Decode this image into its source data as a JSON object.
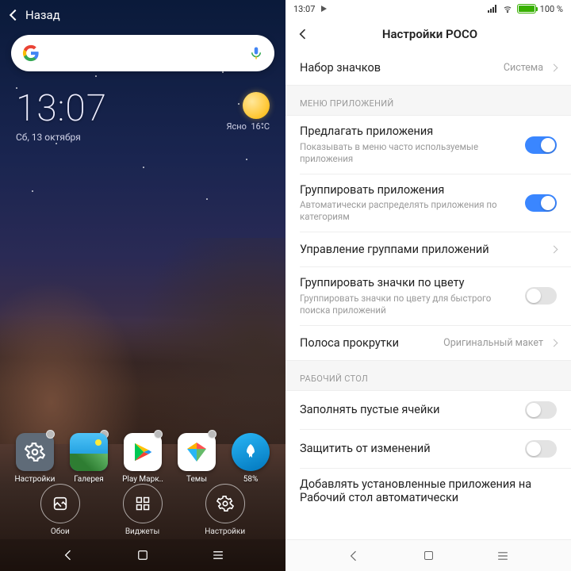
{
  "left": {
    "back_label": "Назад",
    "clock": {
      "time": "13:07",
      "date": "Сб, 13 октября"
    },
    "weather": {
      "desc": "Ясно",
      "temp": "16°C"
    },
    "apps": [
      {
        "name": "settings",
        "label": "Настройки",
        "dot": true
      },
      {
        "name": "gallery",
        "label": "Галерея",
        "dot": true
      },
      {
        "name": "play",
        "label": "Play Марк..",
        "dot": true
      },
      {
        "name": "themes",
        "label": "Темы",
        "dot": true
      },
      {
        "name": "cleaner",
        "label": "58%",
        "dot": false
      }
    ],
    "tools": [
      {
        "name": "wallpaper",
        "label": "Обои"
      },
      {
        "name": "widgets",
        "label": "Виджеты"
      },
      {
        "name": "settings",
        "label": "Настройки"
      }
    ]
  },
  "right": {
    "status": {
      "time": "13:07",
      "battery": "100 %"
    },
    "title": "Настройки POCO",
    "rows": {
      "icons": {
        "title": "Набор значков",
        "value": "Система"
      },
      "section_app": "МЕНЮ ПРИЛОЖЕНИЙ",
      "suggest": {
        "title": "Предлагать приложения",
        "sub": "Показывать в меню часто используемые приложения",
        "on": true
      },
      "group": {
        "title": "Группировать приложения",
        "sub": "Автоматически распределять приложения по категориям",
        "on": true
      },
      "manage": {
        "title": "Управление группами приложений"
      },
      "color": {
        "title": "Группировать значки по цвету",
        "sub": "Группировать значки по цвету для быстрого поиска приложений",
        "on": false
      },
      "scroll": {
        "title": "Полоса прокрутки",
        "value": "Оригинальный макет"
      },
      "section_home": "РАБОЧИЙ СТОЛ",
      "fill": {
        "title": "Заполнять пустые ячейки",
        "on": false
      },
      "lock": {
        "title": "Защитить от изменений",
        "on": false
      },
      "auto": {
        "title": "Добавлять установленные приложения на Рабочий стол автоматически"
      }
    }
  }
}
